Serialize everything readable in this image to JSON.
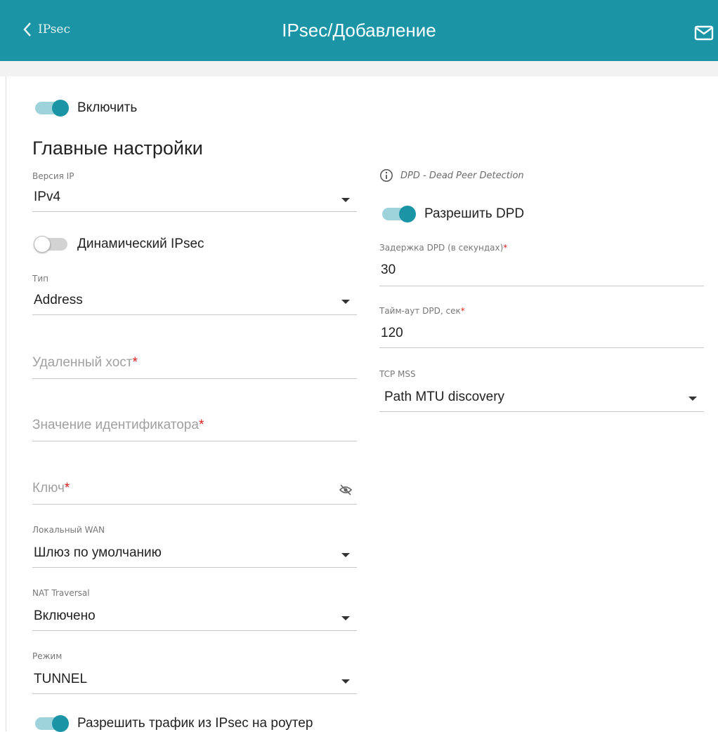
{
  "header": {
    "back_label": "IPsec",
    "title": "IPsec/Добавление",
    "mail_icon": "mail-icon"
  },
  "colors": {
    "accent": "#1b95a6",
    "required": "#d9231e"
  },
  "enable_toggle": {
    "label": "Включить",
    "on": true
  },
  "main_section": {
    "title": "Главные настройки"
  },
  "ip_version": {
    "label": "Версия IP",
    "value": "IPv4"
  },
  "dynamic_ipsec": {
    "label": "Динамический IPsec",
    "on": false
  },
  "type": {
    "label": "Тип",
    "value": "Address"
  },
  "remote_host": {
    "placeholder": "Удаленный хост",
    "required_mark": "*"
  },
  "identifier_value": {
    "placeholder": "Значение идентификатора",
    "required_mark": "*"
  },
  "key": {
    "placeholder": "Ключ",
    "required_mark": "*",
    "visibility_icon": "eye-off-icon"
  },
  "local_wan": {
    "label": "Локальный WAN",
    "value": "Шлюз по умолчанию"
  },
  "nat_traversal": {
    "label": "NAT Traversal",
    "value": "Включено"
  },
  "mode": {
    "label": "Режим",
    "value": "TUNNEL"
  },
  "allow_traffic": {
    "label": "Разрешить трафик из IPsec на роутер",
    "on": true
  },
  "dpd_info": {
    "text": "DPD - Dead Peer Detection",
    "icon": "info-icon"
  },
  "allow_dpd": {
    "label": "Разрешить DPD",
    "on": true
  },
  "dpd_delay": {
    "label": "Задержка DPD (в секундах)",
    "required_mark": "*",
    "value": "30"
  },
  "dpd_timeout": {
    "label": "Тайм-аут DPD, сек",
    "required_mark": "*",
    "value": "120"
  },
  "tcp_mss": {
    "label": "TCP MSS",
    "value": "Path MTU discovery"
  }
}
